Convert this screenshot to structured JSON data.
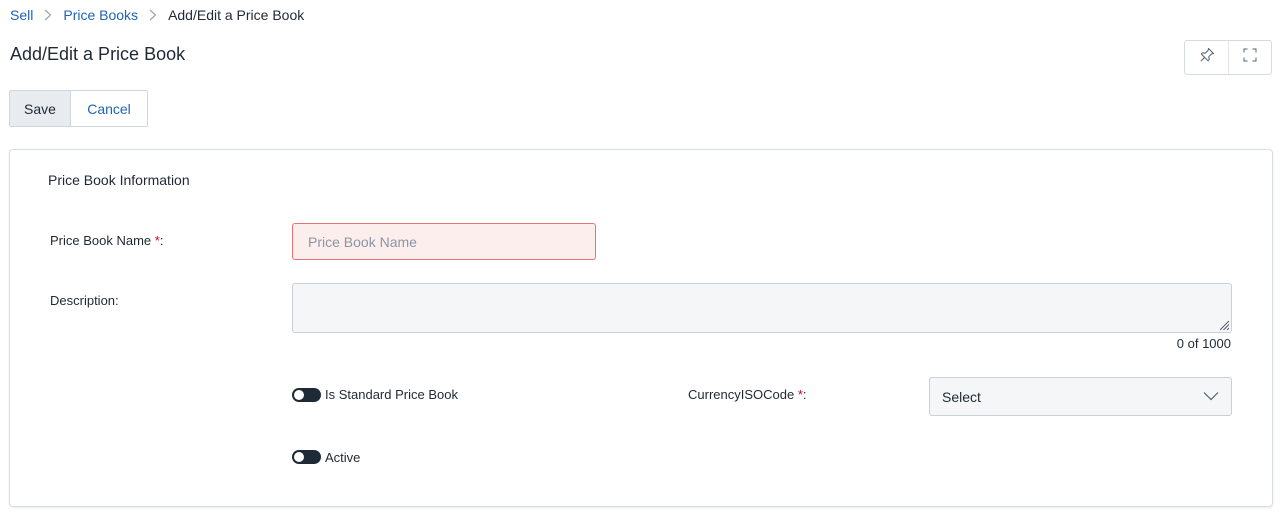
{
  "breadcrumb": {
    "items": [
      "Sell",
      "Price Books"
    ],
    "current": "Add/Edit a Price Book"
  },
  "page": {
    "title": "Add/Edit a Price Book"
  },
  "actions": {
    "save_label": "Save",
    "cancel_label": "Cancel"
  },
  "form": {
    "section_title": "Price Book Information",
    "name": {
      "label": "Price Book Name ",
      "required_mark": "*",
      "colon": ":",
      "placeholder": "Price Book Name",
      "value": ""
    },
    "description": {
      "label": "Description:",
      "value": "",
      "counter": "0 of 1000"
    },
    "is_standard": {
      "label": "Is Standard Price Book",
      "checked": false
    },
    "currency": {
      "label": "CurrencyISOCode ",
      "required_mark": "*",
      "colon": ":",
      "selected": "Select"
    },
    "active": {
      "label": "Active",
      "checked": false
    }
  },
  "icons": {
    "pin": "pin-icon",
    "fullscreen": "fullscreen-icon",
    "chevron": "chevron-down-icon",
    "breadcrumb_sep": "chevron-right-icon"
  },
  "colors": {
    "link": "#1f63b6",
    "required": "#d0021b",
    "toggle_off": "#1f2a37",
    "error_bg": "#fdeeee",
    "error_border": "#e57373"
  }
}
